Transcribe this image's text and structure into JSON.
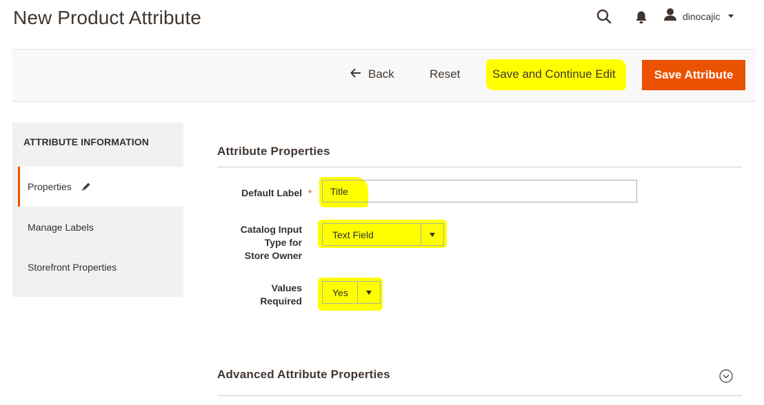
{
  "header": {
    "title": "New Product Attribute",
    "username": "dinocajic",
    "icons": [
      "search-icon",
      "bell-icon",
      "user-icon"
    ]
  },
  "toolbar": {
    "back_label": "Back",
    "reset_label": "Reset",
    "save_continue_label": "Save and Continue Edit",
    "save_label": "Save Attribute"
  },
  "sidebar": {
    "title": "ATTRIBUTE INFORMATION",
    "items": [
      {
        "label": "Properties"
      },
      {
        "label": "Manage Labels"
      },
      {
        "label": "Storefront Properties"
      }
    ]
  },
  "form": {
    "section_title": "Attribute Properties",
    "default_label": {
      "label": "Default Label",
      "required": "*",
      "value": "Title"
    },
    "input_type": {
      "label_line1": "Catalog Input",
      "label_line2": "Type for",
      "label_line3": "Store Owner",
      "value": "Text Field"
    },
    "values_required": {
      "label_line1": "Values",
      "label_line2": "Required",
      "value": "Yes"
    }
  },
  "advanced": {
    "title": "Advanced Attribute Properties"
  },
  "colors": {
    "accent": "#eb5202",
    "highlight": "#ffff00",
    "sidebar_bg": "#f1f1f1"
  }
}
